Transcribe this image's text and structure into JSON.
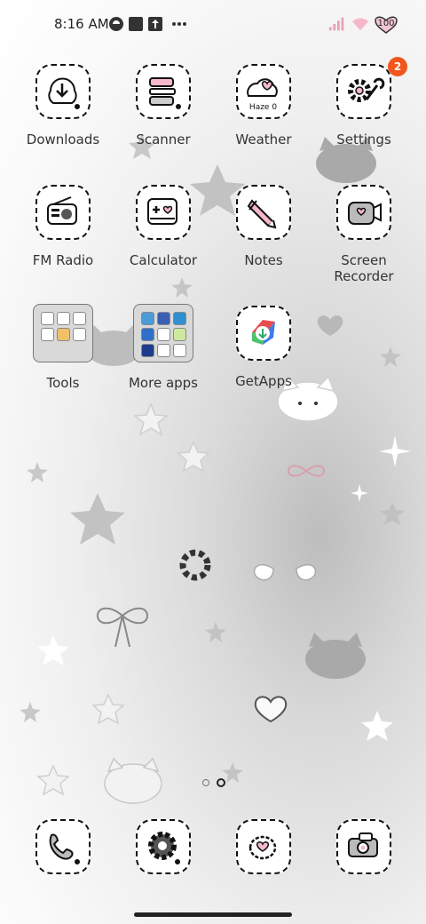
{
  "status_bar": {
    "time": "8:16 AM",
    "battery_level": "100",
    "icons": [
      "app-notification-icon",
      "square-notification-icon",
      "upload-notification-icon",
      "more-notifications-icon",
      "signal-icon",
      "wifi-icon",
      "battery-icon"
    ]
  },
  "apps": {
    "row1": [
      {
        "label": "Downloads",
        "icon": "download-icon"
      },
      {
        "label": "Scanner",
        "icon": "scanner-icon"
      },
      {
        "label": "Weather",
        "icon": "weather-icon",
        "widget_text": "Haze 0"
      },
      {
        "label": "Settings",
        "icon": "gear-icon",
        "badge": "2"
      }
    ],
    "row2": [
      {
        "label": "FM Radio",
        "icon": "radio-icon"
      },
      {
        "label": "Calculator",
        "icon": "calculator-icon"
      },
      {
        "label": "Notes",
        "icon": "pencil-icon"
      },
      {
        "label": "Screen\nRecorder",
        "icon": "recorder-icon"
      }
    ],
    "row3": [
      {
        "label": "Tools",
        "icon": "folder-icon"
      },
      {
        "label": "More apps",
        "icon": "folder-icon"
      },
      {
        "label": "GetApps",
        "icon": "getapps-icon"
      }
    ]
  },
  "page_indicator": {
    "pages": 2,
    "current": 2
  },
  "dock": [
    {
      "icon": "phone-icon"
    },
    {
      "icon": "messages-icon"
    },
    {
      "icon": "browser-icon"
    },
    {
      "icon": "camera-icon"
    }
  ],
  "colors": {
    "badge": "#f2561d",
    "accent_pink": "#f5b8c8",
    "signal": "#e8a0b0"
  }
}
